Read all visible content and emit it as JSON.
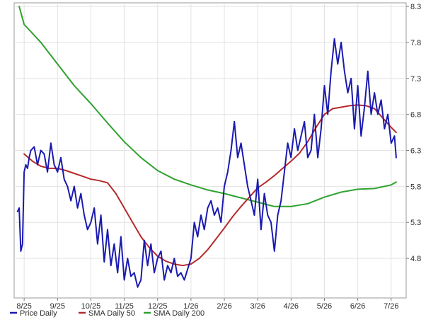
{
  "chart_data": {
    "type": "line",
    "title": "",
    "xlabel": "",
    "ylabel": "",
    "x_ticks": [
      "8/25",
      "9/25",
      "10/25",
      "11/25",
      "12/25",
      "1/26",
      "2/26",
      "3/26",
      "4/26",
      "5/26",
      "6/26",
      "7/26"
    ],
    "y_ticks": [
      4.8,
      5.3,
      5.8,
      6.3,
      6.8,
      7.3,
      7.8,
      8.3
    ],
    "ylim": [
      4.25,
      8.35
    ],
    "xlim": [
      -0.3,
      11.45
    ],
    "grid": true,
    "legend_position": "bottom-left",
    "series": [
      {
        "name": "Price Daily",
        "color": "#1a1ab0",
        "x": [
          -0.2,
          -0.15,
          -0.1,
          -0.05,
          0.0,
          0.05,
          0.1,
          0.15,
          0.2,
          0.3,
          0.4,
          0.5,
          0.6,
          0.7,
          0.8,
          0.9,
          1.0,
          1.1,
          1.2,
          1.3,
          1.4,
          1.5,
          1.6,
          1.7,
          1.8,
          1.9,
          2.0,
          2.1,
          2.2,
          2.3,
          2.4,
          2.5,
          2.6,
          2.7,
          2.8,
          2.9,
          3.0,
          3.1,
          3.2,
          3.3,
          3.4,
          3.5,
          3.6,
          3.7,
          3.8,
          3.9,
          4.0,
          4.1,
          4.2,
          4.3,
          4.4,
          4.5,
          4.6,
          4.7,
          4.8,
          4.9,
          5.0,
          5.1,
          5.2,
          5.3,
          5.4,
          5.5,
          5.6,
          5.7,
          5.8,
          5.9,
          6.0,
          6.1,
          6.2,
          6.3,
          6.4,
          6.5,
          6.6,
          6.7,
          6.8,
          6.9,
          7.0,
          7.1,
          7.2,
          7.3,
          7.4,
          7.5,
          7.6,
          7.7,
          7.8,
          7.9,
          8.0,
          8.1,
          8.2,
          8.3,
          8.4,
          8.5,
          8.6,
          8.7,
          8.8,
          8.9,
          9.0,
          9.1,
          9.2,
          9.3,
          9.4,
          9.5,
          9.6,
          9.7,
          9.8,
          9.9,
          10.0,
          10.1,
          10.2,
          10.3,
          10.4,
          10.5,
          10.6,
          10.7,
          10.8,
          10.9,
          11.0,
          11.1,
          11.15
        ],
        "values": [
          5.45,
          5.5,
          4.9,
          5.0,
          6.0,
          6.1,
          6.05,
          6.2,
          6.3,
          6.35,
          6.1,
          6.3,
          6.25,
          6.0,
          6.4,
          6.1,
          6.0,
          6.2,
          5.9,
          5.8,
          5.6,
          5.8,
          5.5,
          5.7,
          5.4,
          5.2,
          5.3,
          5.5,
          5.0,
          5.4,
          4.75,
          5.2,
          4.7,
          5.0,
          4.6,
          5.1,
          4.5,
          4.8,
          4.55,
          4.6,
          4.4,
          4.5,
          5.05,
          4.7,
          5.0,
          4.6,
          4.8,
          4.9,
          4.5,
          4.7,
          4.6,
          4.8,
          4.55,
          4.6,
          4.5,
          4.65,
          4.8,
          5.3,
          5.1,
          5.4,
          5.2,
          5.5,
          5.6,
          5.4,
          5.5,
          5.3,
          5.8,
          6.0,
          6.3,
          6.7,
          6.2,
          6.4,
          6.1,
          5.8,
          5.6,
          5.4,
          5.9,
          5.2,
          5.7,
          5.4,
          5.3,
          4.9,
          5.4,
          5.6,
          6.0,
          6.4,
          6.2,
          6.6,
          6.3,
          6.5,
          6.7,
          6.2,
          6.3,
          6.8,
          6.2,
          6.6,
          7.2,
          6.8,
          7.4,
          7.85,
          7.5,
          7.8,
          7.4,
          7.1,
          7.3,
          6.6,
          7.2,
          6.5,
          6.9,
          7.4,
          6.8,
          7.1,
          6.8,
          7.0,
          6.6,
          6.8,
          6.4,
          6.5,
          6.2
        ]
      },
      {
        "name": "SMA Daily 50",
        "color": "#b52a2a",
        "x": [
          0,
          0.25,
          0.5,
          0.75,
          1.0,
          1.25,
          1.5,
          1.75,
          2.0,
          2.25,
          2.5,
          2.75,
          3.0,
          3.25,
          3.5,
          3.75,
          4.0,
          4.25,
          4.5,
          4.75,
          5.0,
          5.25,
          5.5,
          5.75,
          6.0,
          6.25,
          6.5,
          6.75,
          7.0,
          7.25,
          7.5,
          7.75,
          8.0,
          8.25,
          8.5,
          8.75,
          9.0,
          9.25,
          9.5,
          9.75,
          10.0,
          10.25,
          10.5,
          10.75,
          11.0,
          11.15
        ],
        "values": [
          6.25,
          6.15,
          6.08,
          6.05,
          6.05,
          6.02,
          5.98,
          5.94,
          5.9,
          5.88,
          5.85,
          5.7,
          5.5,
          5.3,
          5.1,
          4.95,
          4.83,
          4.76,
          4.72,
          4.7,
          4.72,
          4.8,
          4.92,
          5.07,
          5.22,
          5.38,
          5.52,
          5.65,
          5.78,
          5.86,
          5.95,
          6.05,
          6.15,
          6.26,
          6.42,
          6.62,
          6.8,
          6.88,
          6.9,
          6.92,
          6.93,
          6.92,
          6.88,
          6.75,
          6.62,
          6.55
        ]
      },
      {
        "name": "SMA Daily 200",
        "color": "#2fa12f",
        "x": [
          -0.15,
          0.0,
          0.5,
          1.0,
          1.5,
          2.0,
          2.5,
          3.0,
          3.5,
          4.0,
          4.5,
          5.0,
          5.5,
          6.0,
          6.5,
          7.0,
          7.5,
          8.0,
          8.5,
          9.0,
          9.5,
          10.0,
          10.5,
          11.0,
          11.15
        ],
        "values": [
          8.3,
          8.05,
          7.8,
          7.5,
          7.2,
          6.95,
          6.68,
          6.42,
          6.2,
          6.02,
          5.9,
          5.82,
          5.75,
          5.7,
          5.64,
          5.58,
          5.52,
          5.52,
          5.56,
          5.65,
          5.72,
          5.76,
          5.77,
          5.82,
          5.86
        ]
      }
    ]
  }
}
